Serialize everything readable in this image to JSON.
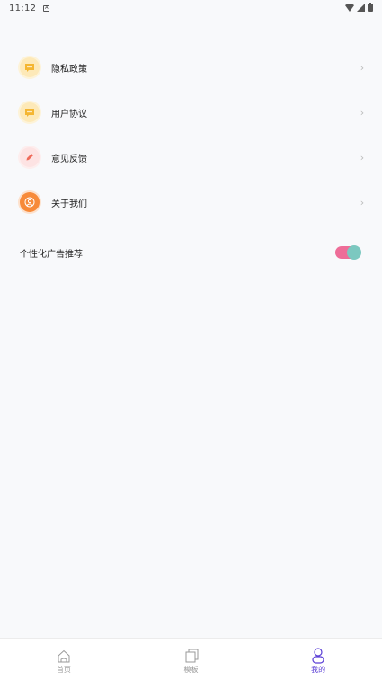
{
  "status_bar": {
    "time": "11:12",
    "notif_glyph": "A"
  },
  "menu": {
    "items": [
      {
        "label": "隐私政策",
        "icon": "privacy-chat-icon"
      },
      {
        "label": "用户协议",
        "icon": "agreement-chat-icon"
      },
      {
        "label": "意见反馈",
        "icon": "feedback-pen-icon"
      },
      {
        "label": "关于我们",
        "icon": "about-user-icon"
      }
    ],
    "chevron": "›"
  },
  "personalized_ads": {
    "label": "个性化广告推荐",
    "enabled": true
  },
  "bottom_nav": {
    "items": [
      {
        "label": "首页",
        "icon": "home-icon",
        "active": false
      },
      {
        "label": "模板",
        "icon": "template-icon",
        "active": false
      },
      {
        "label": "我的",
        "icon": "profile-icon",
        "active": true
      }
    ]
  },
  "colors": {
    "accent": "#5b3fd6",
    "toggle_track": "#ee6d98",
    "toggle_knob": "#7cc8c0",
    "background": "#f8f9fb"
  }
}
